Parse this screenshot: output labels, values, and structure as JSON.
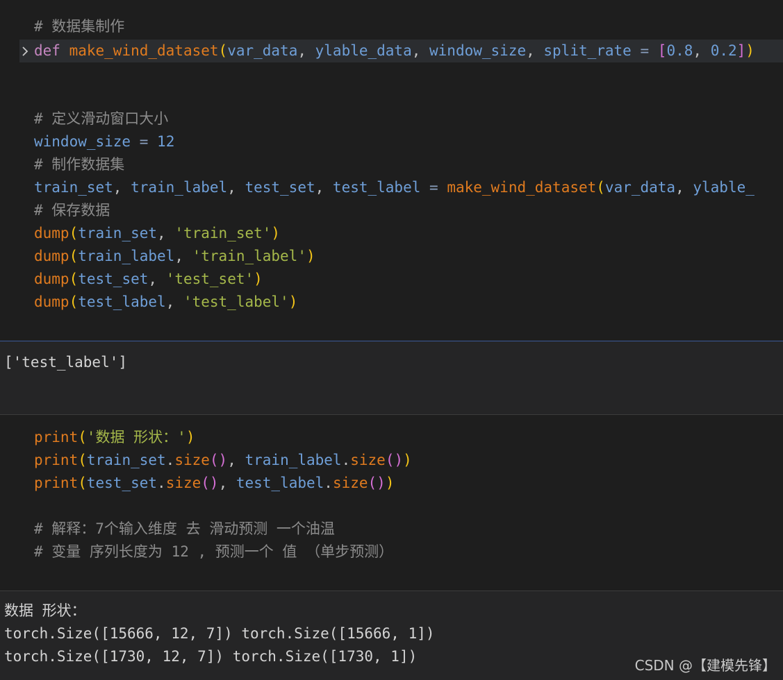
{
  "cell1": {
    "comment_dataset": "# 数据集制作",
    "fold_icon": "chevron-right-icon",
    "def_kw": "def",
    "def_name": "make_wind_dataset",
    "def_p1": "var_data",
    "def_p2": "ylable_data",
    "def_p3": "window_size",
    "def_p4": "split_rate",
    "def_eq": "=",
    "def_n1": "0.8",
    "def_n2": "0.2",
    "comment_window": "# 定义滑动窗口大小",
    "window_var": "window_size",
    "window_eq": "=",
    "window_val": "12",
    "comment_make": "# 制作数据集",
    "assign_v1": "train_set",
    "assign_v2": "train_label",
    "assign_v3": "test_set",
    "assign_v4": "test_label",
    "assign_eq": "=",
    "assign_func": "make_wind_dataset",
    "assign_a1": "var_data",
    "assign_a2": "ylable_",
    "comment_save": "# 保存数据",
    "dump_func": "dump",
    "dump1_arg": "train_set",
    "dump1_str": "'train_set'",
    "dump2_arg": "train_label",
    "dump2_str": "'train_label'",
    "dump3_arg": "test_set",
    "dump3_str": "'test_set'",
    "dump4_arg": "test_label",
    "dump4_str": "'test_label'"
  },
  "output1": {
    "line": "['test_label']"
  },
  "cell2": {
    "print_func": "print",
    "str1": "'数据 形状：'",
    "size_fn": "size",
    "p2_a": "train_set",
    "p2_b": "train_label",
    "p3_a": "test_set",
    "p3_b": "test_label",
    "comment1": "# 解释：7个输入维度 去 滑动预测 一个油温",
    "comment2": "# 变量 序列长度为 12 , 预测一个 值 （单步预测）"
  },
  "output2": {
    "line1": "数据 形状：",
    "line2": "torch.Size([15666, 12, 7]) torch.Size([15666, 1])",
    "line3": "torch.Size([1730, 12, 7]) torch.Size([1730, 1])"
  },
  "watermark": "CSDN @【建模先锋】",
  "colors": {
    "background": "#1e1e1e",
    "output_background": "#252526",
    "separator_blue": "#3b5a9a",
    "separator_grey": "#3c3c3c"
  }
}
